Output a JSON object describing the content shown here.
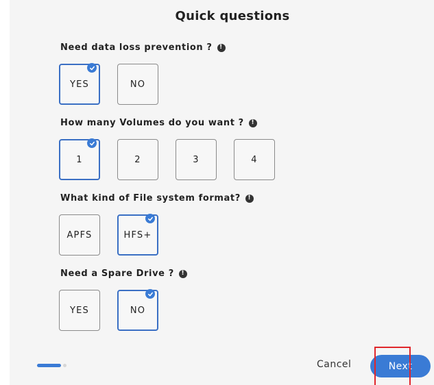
{
  "title": "Quick questions",
  "questions": [
    {
      "label": "Need data loss prevention ?",
      "options": [
        "YES",
        "NO"
      ],
      "selected": "YES"
    },
    {
      "label": "How many Volumes do you want ?",
      "options": [
        "1",
        "2",
        "3",
        "4"
      ],
      "selected": "1"
    },
    {
      "label": "What kind of File system format?",
      "options": [
        "APFS",
        "HFS+"
      ],
      "selected": "HFS+"
    },
    {
      "label": "Need a Spare Drive ?",
      "options": [
        "YES",
        "NO"
      ],
      "selected": "NO"
    }
  ],
  "footer": {
    "cancel_label": "Cancel",
    "next_label": "Next"
  },
  "colors": {
    "accent": "#3a7bd5",
    "highlight": "#e0262b"
  },
  "icons": {
    "info": "info-icon",
    "check": "check-icon"
  }
}
